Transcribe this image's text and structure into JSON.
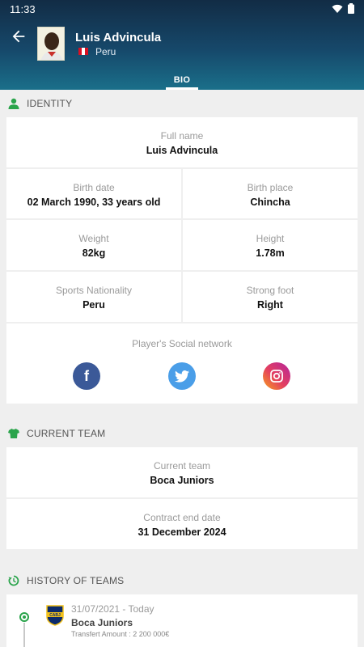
{
  "status_bar": {
    "time": "11:33"
  },
  "player": {
    "name": "Luis Advincula",
    "country": "Peru"
  },
  "tabs": [
    {
      "label": "BIO"
    }
  ],
  "identity": {
    "section_title": "IDENTITY",
    "full_name": {
      "label": "Full name",
      "value": "Luis Advincula"
    },
    "birth_date": {
      "label": "Birth date",
      "value": "02 March 1990, 33 years old"
    },
    "birth_place": {
      "label": "Birth place",
      "value": "Chincha"
    },
    "weight": {
      "label": "Weight",
      "value": "82kg"
    },
    "height": {
      "label": "Height",
      "value": "1.78m"
    },
    "sports_nationality": {
      "label": "Sports Nationality",
      "value": "Peru"
    },
    "strong_foot": {
      "label": "Strong foot",
      "value": "Right"
    },
    "social": {
      "title": "Player's Social network",
      "facebook_glyph": "f",
      "colors": {
        "facebook": "#3b5998",
        "twitter": "#4a9ee8",
        "instagram": "#d62a6e"
      }
    }
  },
  "current_team": {
    "section_title": "CURRENT TEAM",
    "team": {
      "label": "Current team",
      "value": "Boca Juniors"
    },
    "contract": {
      "label": "Contract end date",
      "value": "31 December 2024"
    }
  },
  "history": {
    "section_title": "HISTORY OF TEAMS",
    "items": [
      {
        "dates": "31/07/2021 - Today",
        "team": "Boca Juniors",
        "transfer": "Transfert Amount : 2 200 000€",
        "crest_text": "CABJ"
      }
    ]
  },
  "colors": {
    "accent_green": "#2aa44b",
    "header_dark": "#122c45",
    "header_light": "#1a6f8a"
  }
}
